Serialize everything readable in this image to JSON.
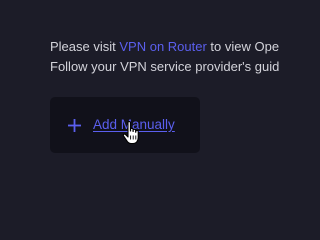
{
  "info": {
    "line1_prefix": "Please visit ",
    "line1_link": "VPN on Router",
    "line1_suffix": " to view Ope",
    "line2": "Follow your VPN service provider's guid"
  },
  "add_manually": {
    "label": "Add Manually",
    "icon": "plus-icon"
  },
  "cursor": {
    "icon": "hand-pointer-cursor-icon"
  },
  "colors": {
    "background": "#1c1c28",
    "card": "#11111a",
    "accent": "#5b5fee",
    "text": "#d3d3da"
  }
}
